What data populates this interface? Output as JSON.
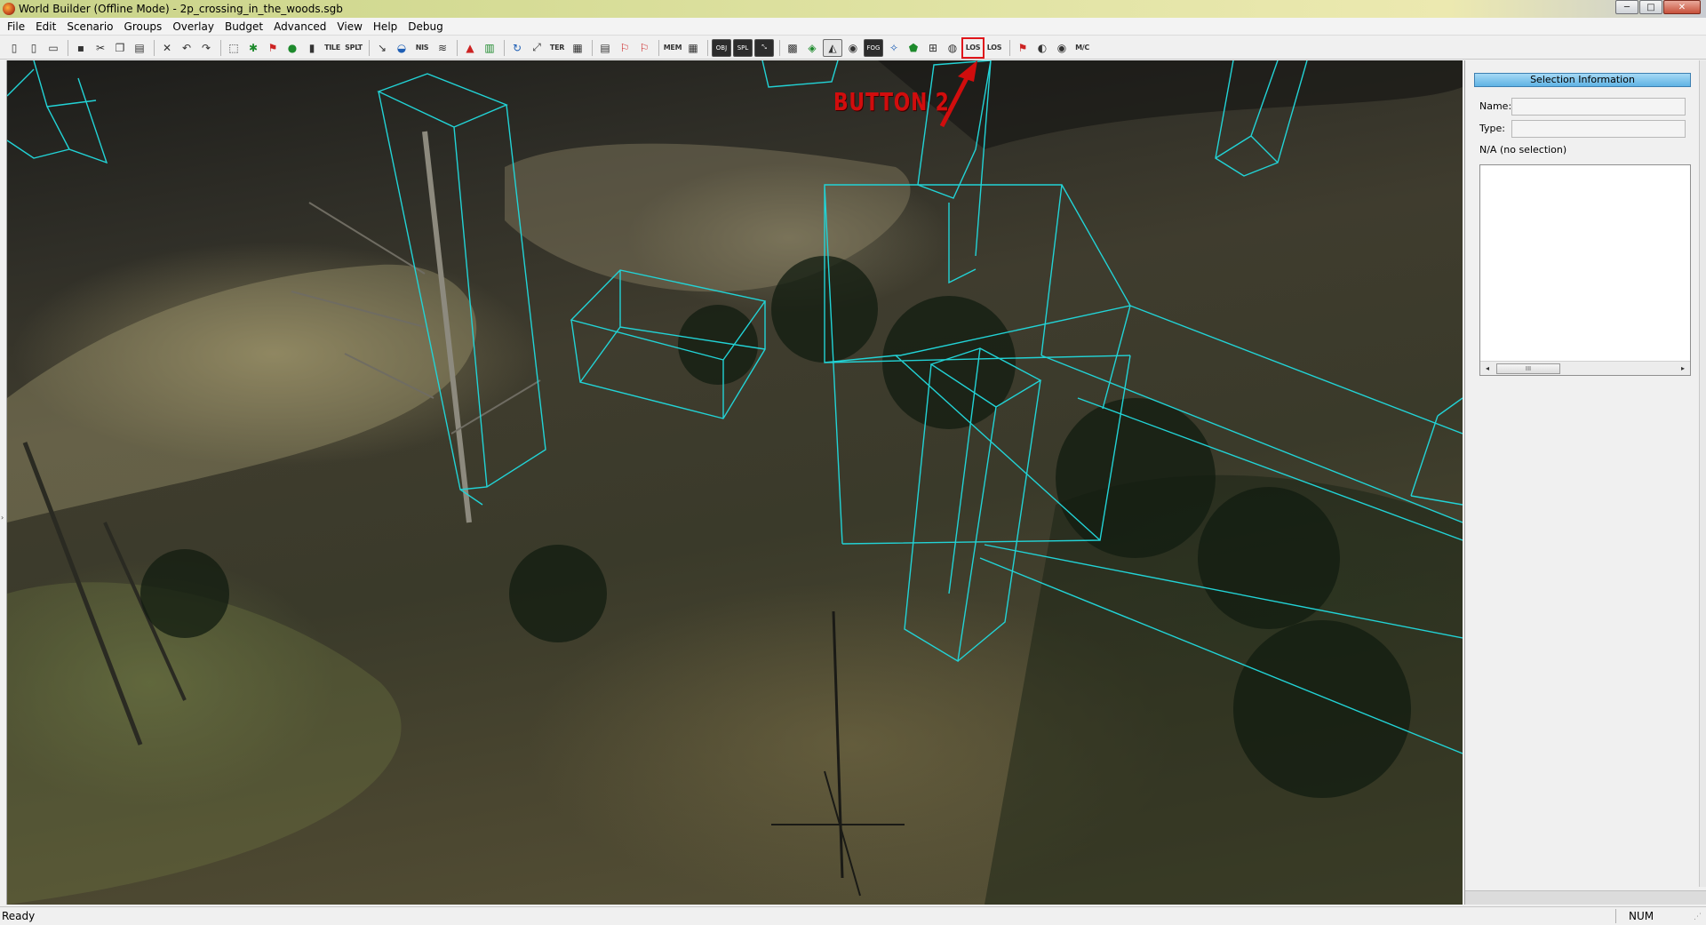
{
  "window": {
    "title": "World Builder (Offline Mode) - 2p_crossing_in_the_woods.sgb",
    "minimize_glyph": "─",
    "maximize_glyph": "□",
    "close_glyph": "✕"
  },
  "menu": {
    "items": [
      "File",
      "Edit",
      "Scenario",
      "Groups",
      "Overlay",
      "Budget",
      "Advanced",
      "View",
      "Help",
      "Debug"
    ]
  },
  "toolbar": {
    "tile_label": "TILE",
    "split_label": "SPLT",
    "nis_label": "NIS",
    "ter_label": "TER",
    "mem_label": "MEM",
    "obj_label": "OBJ",
    "spl_label": "SPL",
    "fog_label": "FOG",
    "los_label": "LOS",
    "los2_label": "LOS",
    "misc_label": "M/C"
  },
  "viewport": {
    "annotation": "BUTTON 2",
    "wireframe_color": "#22d3d6",
    "annotation_color": "#d10d0d"
  },
  "panel": {
    "header": "Selection Information",
    "name_label": "Name:",
    "type_label": "Type:",
    "name_value": "",
    "type_value": "",
    "selection_status": "N/A (no selection)",
    "scroll_thumb": "III",
    "scroll_left": "◂",
    "scroll_right": "▸"
  },
  "status": {
    "text": "Ready",
    "num_indicator": "NUM"
  }
}
